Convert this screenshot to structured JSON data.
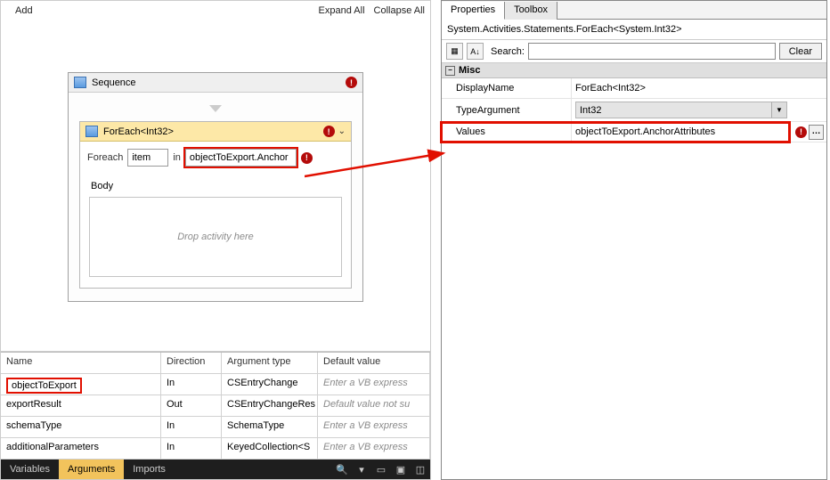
{
  "leftToolbar": {
    "add": "Add",
    "expandAll": "Expand All",
    "collapseAll": "Collapse All"
  },
  "sequence": {
    "title": "Sequence"
  },
  "foreach": {
    "title": "ForEach<Int32>",
    "foreachLabel": "Foreach",
    "itemValue": "item",
    "inLabel": "in",
    "valuesExpr": "objectToExport.Anchor",
    "bodyLabel": "Body",
    "dropHint": "Drop activity here"
  },
  "argGrid": {
    "headers": {
      "name": "Name",
      "direction": "Direction",
      "argType": "Argument type",
      "default": "Default value"
    },
    "rows": [
      {
        "name": "objectToExport",
        "direction": "In",
        "type": "CSEntryChange",
        "default": "Enter a VB express",
        "ph": true,
        "highlight": true
      },
      {
        "name": "exportResult",
        "direction": "Out",
        "type": "CSEntryChangeRes",
        "default": "Default value not su",
        "ph": true
      },
      {
        "name": "schemaType",
        "direction": "In",
        "type": "SchemaType",
        "default": "Enter a VB express",
        "ph": true
      },
      {
        "name": "additionalParameters",
        "direction": "In",
        "type": "KeyedCollection<S",
        "default": "Enter a VB express",
        "ph": true
      }
    ]
  },
  "bottomTabs": {
    "variables": "Variables",
    "arguments": "Arguments",
    "imports": "Imports"
  },
  "rightPanel": {
    "tabs": {
      "properties": "Properties",
      "toolbox": "Toolbox"
    },
    "typeLine": "System.Activities.Statements.ForEach<System.Int32>",
    "searchLabel": "Search:",
    "clear": "Clear",
    "category": "Misc",
    "props": {
      "displayName": {
        "label": "DisplayName",
        "value": "ForEach<Int32>"
      },
      "typeArgument": {
        "label": "TypeArgument",
        "value": "Int32"
      },
      "values": {
        "label": "Values",
        "value": "objectToExport.AnchorAttributes"
      }
    }
  }
}
